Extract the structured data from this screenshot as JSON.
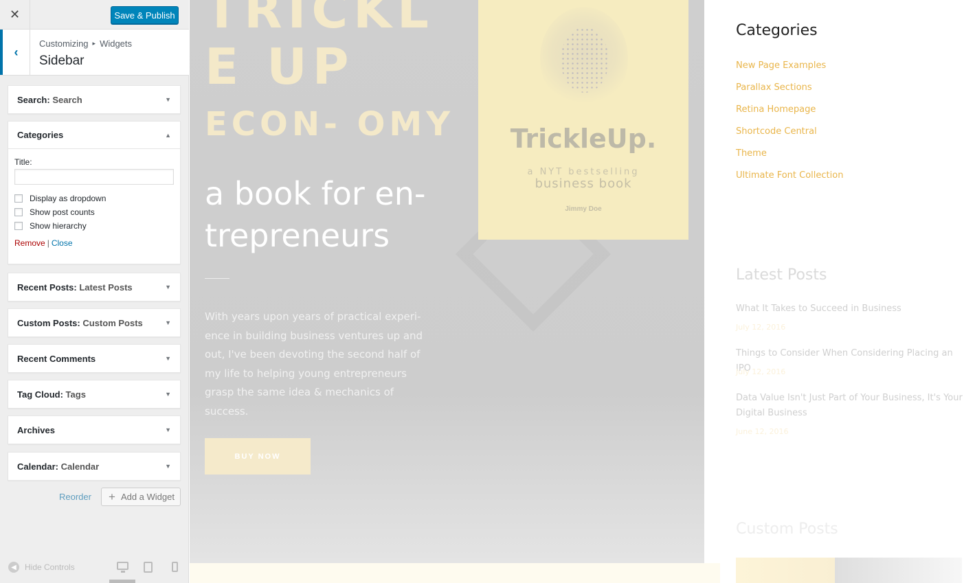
{
  "customizer": {
    "close_label": "✕",
    "publish_label": "Save & Publish",
    "back_icon": "‹",
    "breadcrumb": [
      "Customizing",
      "Widgets"
    ],
    "breadcrumb_sep": "▸",
    "section_title": "Sidebar",
    "widgets": [
      {
        "name": "Search",
        "sub": "Search",
        "open": false
      },
      {
        "name": "Categories",
        "sub": "",
        "open": true
      },
      {
        "name": "Recent Posts",
        "sub": "Latest Posts",
        "open": false
      },
      {
        "name": "Custom Posts",
        "sub": "Custom Posts",
        "open": false
      },
      {
        "name": "Recent Comments",
        "sub": "",
        "open": false
      },
      {
        "name": "Tag Cloud",
        "sub": "Tags",
        "open": false
      },
      {
        "name": "Archives",
        "sub": "",
        "open": false
      },
      {
        "name": "Calendar",
        "sub": "Calendar",
        "open": false
      }
    ],
    "categories_form": {
      "title_label": "Title:",
      "title_value": "",
      "checkboxes": [
        "Display as dropdown",
        "Show post counts",
        "Show hierarchy"
      ],
      "remove_label": "Remove",
      "separator": "|",
      "close_label": "Close"
    },
    "reorder_label": "Reorder",
    "add_widget_label": "Add a Widget",
    "hide_controls_label": "Hide Controls"
  },
  "preview": {
    "hero": {
      "headline_1": "TRICKL E UP",
      "headline_2": "ECON- OMY",
      "subtitle": "a book for en- trepreneurs",
      "body": "With years upon years of practical experi- ence in building business ventures up and out, I've been devoting the second half of my life to helping young entrepreneurs grasp the same idea & mechanics of success.",
      "button": "BUY NOW"
    },
    "book": {
      "title": "TrickleUp.",
      "sub1": "a NYT bestselling",
      "sub2": "business book",
      "author": "Jimmy Doe"
    },
    "sidebar": {
      "categories_heading": "Categories",
      "categories": [
        "New Page Examples",
        "Parallax Sections",
        "Retina Homepage",
        "Shortcode Central",
        "Theme",
        "Ultimate Font Collection"
      ],
      "latest_heading": "Latest Posts",
      "posts": [
        {
          "title": "What It Takes to Succeed in Business",
          "date": "July 12, 2016"
        },
        {
          "title": "Things to Consider When Considering Placing an IPO",
          "date": "July 12, 2016"
        },
        {
          "title": "Data Value Isn't Just Part of Your Business, It's Your Digital Business",
          "date": "June 12, 2016"
        }
      ],
      "custom_heading": "Custom Posts"
    }
  },
  "colors": {
    "accent": "#0073aa",
    "publish": "#0085ba",
    "category_link": "#e9b54a",
    "remove": "#aa0000"
  }
}
